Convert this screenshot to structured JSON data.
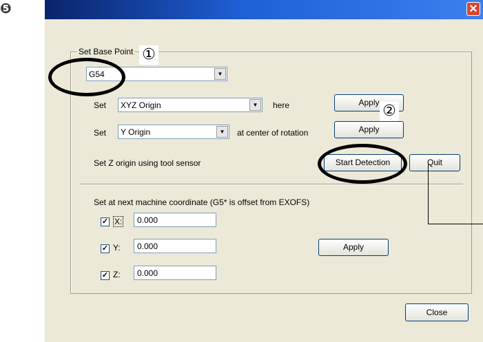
{
  "step_marker": "❺",
  "window": {
    "close_glyph": "✕"
  },
  "base_group": {
    "legend": "Set Base Point",
    "current": "G54"
  },
  "rows": {
    "xyz": {
      "prefix": "Set",
      "value": "XYZ Origin",
      "suffix": "here",
      "button": "Apply"
    },
    "rot": {
      "prefix": "Set",
      "value": "Y Origin",
      "suffix": "at center of rotation",
      "button": "Apply"
    },
    "zsensor": {
      "label": "Set Z origin using tool sensor",
      "start_button": "Start Detection",
      "quit_button": "Quit"
    }
  },
  "machine": {
    "heading": "Set at next machine coordinate  (G5* is offset from EXOFS)",
    "axes": [
      {
        "label": "X:",
        "value": "0.000",
        "checked": true
      },
      {
        "label": "Y:",
        "value": "0.000",
        "checked": true
      },
      {
        "label": "Z:",
        "value": "0.000",
        "checked": true
      }
    ],
    "apply": "Apply"
  },
  "callouts": {
    "one": "①",
    "two": "②"
  },
  "close_button": "Close"
}
